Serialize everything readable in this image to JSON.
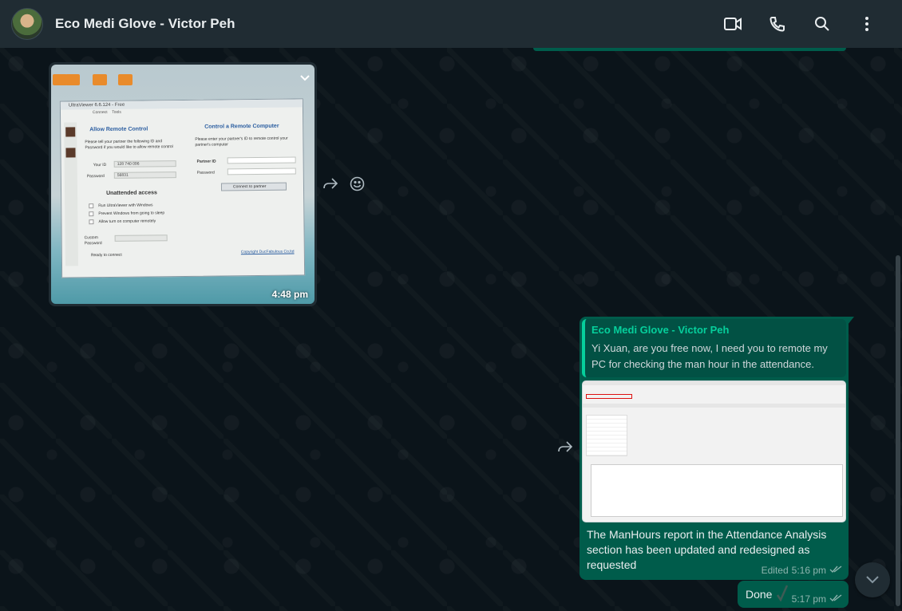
{
  "header": {
    "title": "Eco Medi Glove - Victor Peh",
    "actions": [
      "video-call-icon",
      "voice-call-icon",
      "search-icon",
      "menu-icon"
    ]
  },
  "messages": {
    "image_in": {
      "time": "4:48 pm",
      "ultraviewer": {
        "window_title": "UltraViewer 6.6.124 - Free",
        "menu": [
          "Connect",
          "Tools"
        ],
        "allow_title": "Allow Remote Control",
        "allow_desc": "Please tell your partner the following ID and Password if you would like to allow remote control",
        "your_id_label": "Your ID",
        "your_id_value": "128 740 096",
        "password_label": "Password",
        "password_value": "56831",
        "control_title": "Control a Remote Computer",
        "control_desc": "Please enter your partner's ID to remote control your partner's computer",
        "partner_id_label": "Partner ID",
        "partner_password_label": "Password",
        "connect_button": "Connect to partner",
        "unattended_title": "Unattended access",
        "check1": "Run UltraViewer with Windows",
        "check2": "Prevent Windows from going to sleep",
        "check3": "Allow turn on computer remotely",
        "custom_password_label": "Custom Password",
        "status": "Ready to connect",
        "copyright": "Copyright DucFabulous Co,ltd"
      }
    },
    "reply_out": {
      "quoted_author": "Eco Medi Glove - Victor Peh",
      "quoted_text": "Yi Xuan, are you free now, I need you to remote my PC for checking the man hour in the attendance.",
      "text": "The ManHours report in the Attendance Analysis section has been updated and redesigned as requested",
      "edited_label": "Edited",
      "time": "5:16 pm"
    },
    "done_out": {
      "text": "Done",
      "time": "5:17 pm"
    }
  },
  "colors": {
    "background": "#0b141a",
    "header": "#202c33",
    "outgoing": "#005c4b",
    "incoming": "#202c33",
    "accent": "#06cf9c"
  }
}
